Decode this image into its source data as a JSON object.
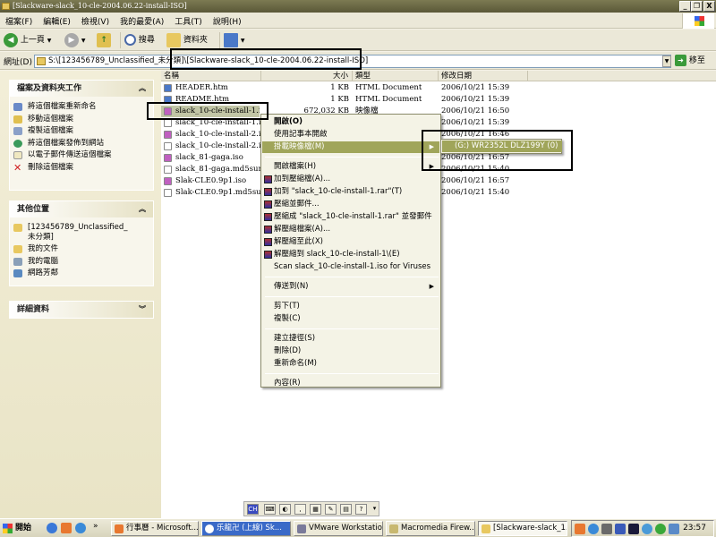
{
  "window": {
    "title": "[Slackware-slack_10-cle-2004.06.22-install-ISO]"
  },
  "window_controls": {
    "minimize": "_",
    "restore": "❐",
    "close": "X"
  },
  "menubar": [
    "檔案(F)",
    "編輯(E)",
    "檢視(V)",
    "我的最愛(A)",
    "工具(T)",
    "說明(H)"
  ],
  "toolbar": {
    "back": "上一頁",
    "search": "搜尋",
    "folders": "資料夾"
  },
  "address": {
    "label": "網址(D)",
    "value": "S:\\[123456789_Unclassified_未分類]\\[Slackware-slack_10-cle-2004.06.22-install-ISO]",
    "go": "移至"
  },
  "tasks": {
    "title": "檔案及資料夾工作",
    "items": [
      "將這個檔案重新命名",
      "移動這個檔案",
      "複製這個檔案",
      "將這個檔案發佈到網站",
      "以電子郵件傳送這個檔案",
      "刪除這個檔案"
    ]
  },
  "places": {
    "title": "其他位置",
    "items": [
      "[123456789_Unclassified_未分類]",
      "我的文件",
      "我的電腦",
      "網路芳鄰"
    ]
  },
  "details": {
    "title": "詳細資料"
  },
  "columns": {
    "name": "名稱",
    "size": "大小",
    "type": "類型",
    "modified": "修改日期"
  },
  "files": [
    {
      "name": "HEADER.htm",
      "size": "1 KB",
      "type": "HTML Document",
      "modified": "2006/10/21 15:39",
      "icon": "html"
    },
    {
      "name": "README.htm",
      "size": "1 KB",
      "type": "HTML Document",
      "modified": "2006/10/21 15:39",
      "icon": "html"
    },
    {
      "name": "slack_10-cle-install-1.iso",
      "size": "672,032 KB",
      "type": "映像檔",
      "modified": "2006/10/21 16:50",
      "icon": "iso"
    },
    {
      "name": "slack_10-cle-install-1.iso.",
      "size": "",
      "type": "",
      "modified": "2006/10/21 15:39",
      "icon": "txt"
    },
    {
      "name": "slack_10-cle-install-2.iso",
      "size": "",
      "type": "",
      "modified": "2006/10/21 16:46",
      "icon": "iso"
    },
    {
      "name": "slack_10-cle-install-2.iso.",
      "size": "",
      "type": "",
      "modified": "2006/10/21 15:39",
      "icon": "txt"
    },
    {
      "name": "slack_81-gaga.iso",
      "size": "",
      "type": "",
      "modified": "2006/10/21 16:57",
      "icon": "iso"
    },
    {
      "name": "slack_81-gaga.md5sum.t",
      "size": "",
      "type": "",
      "modified": "2006/10/21 15:40",
      "icon": "txt"
    },
    {
      "name": "Slak-CLE0.9p1.iso",
      "size": "",
      "type": "",
      "modified": "2006/10/21 16:57",
      "icon": "iso"
    },
    {
      "name": "Slak-CLE0.9p1.md5sum.",
      "size": "",
      "type": "",
      "modified": "2006/10/21 15:40",
      "icon": "txt"
    }
  ],
  "context_menu": [
    {
      "label": "開啟(O)",
      "bold": true
    },
    {
      "label": "使用記事本開啟"
    },
    {
      "label": "掛載映像檔(M)",
      "submenu": true,
      "highlight": true
    },
    {
      "sep": true
    },
    {
      "label": "開啟檔案(H)",
      "submenu": true
    },
    {
      "label": "加到壓縮檔(A)...",
      "rar": true
    },
    {
      "label": "加到 \"slack_10-cle-install-1.rar\"(T)",
      "rar": true
    },
    {
      "label": "壓縮並郵件...",
      "rar": true
    },
    {
      "label": "壓縮成 \"slack_10-cle-install-1.rar\" 並發郵件",
      "rar": true
    },
    {
      "label": "解壓縮檔案(A)...",
      "rar": true
    },
    {
      "label": "解壓縮至此(X)",
      "rar": true
    },
    {
      "label": "解壓縮到 slack_10-cle-install-1\\(E)",
      "rar": true
    },
    {
      "label": "Scan slack_10-cle-install-1.iso for Viruses"
    },
    {
      "sep": true
    },
    {
      "label": "傳送到(N)",
      "submenu": true
    },
    {
      "sep": true
    },
    {
      "label": "剪下(T)"
    },
    {
      "label": "複製(C)"
    },
    {
      "sep": true
    },
    {
      "label": "建立捷徑(S)"
    },
    {
      "label": "刪除(D)"
    },
    {
      "label": "重新命名(M)"
    },
    {
      "sep": true
    },
    {
      "label": "內容(R)"
    }
  ],
  "submenu": {
    "item": "(G:) WR2352L DLZ199Y (0)"
  },
  "taskbar": {
    "start": "開始",
    "buttons": [
      "行事曆 - Microsoft...",
      "乐龍卍 (上線) Sk...",
      "VMware Workstation",
      "Macromedia Firew...",
      "[Slackware-slack_1..."
    ],
    "clock": "23:57"
  },
  "langbar": {
    "lang": "CH"
  },
  "colors": {
    "selection": "#c2c6a6",
    "menu_highlight": "#a0a55a",
    "titlebar": "#6b6944"
  }
}
